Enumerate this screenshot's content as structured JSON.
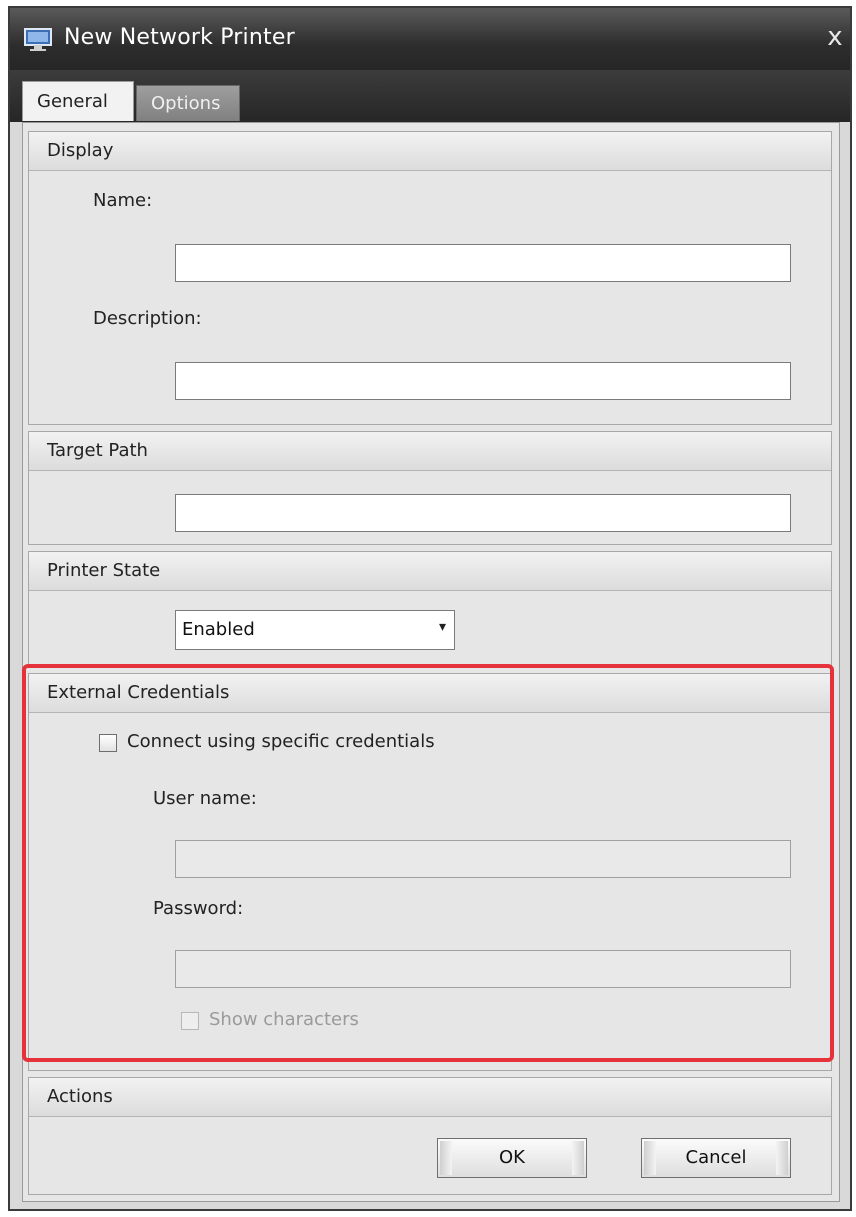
{
  "window": {
    "title": "New Network Printer",
    "close_glyph": "x"
  },
  "tabs": [
    {
      "label": "General",
      "active": true
    },
    {
      "label": "Options",
      "active": false
    }
  ],
  "display": {
    "header": "Display",
    "name_label": "Name:",
    "name_value": "",
    "description_label": "Description:",
    "description_value": ""
  },
  "target_path": {
    "header": "Target Path",
    "value": ""
  },
  "printer_state": {
    "header": "Printer State",
    "selected": "Enabled"
  },
  "external_credentials": {
    "header": "External Credentials",
    "connect_label": "Connect using specific credentials",
    "connect_checked": false,
    "username_label": "User name:",
    "username_value": "",
    "password_label": "Password:",
    "password_value": "",
    "show_characters_label": "Show characters",
    "show_characters_checked": false
  },
  "actions": {
    "header": "Actions",
    "ok_label": "OK",
    "cancel_label": "Cancel"
  },
  "colors": {
    "highlight": "#e5323b",
    "titlebar": "#2d2d2d"
  },
  "icons": {
    "app": "monitor-printer-icon",
    "close": "close-icon",
    "dropdown": "chevron-down-icon"
  }
}
